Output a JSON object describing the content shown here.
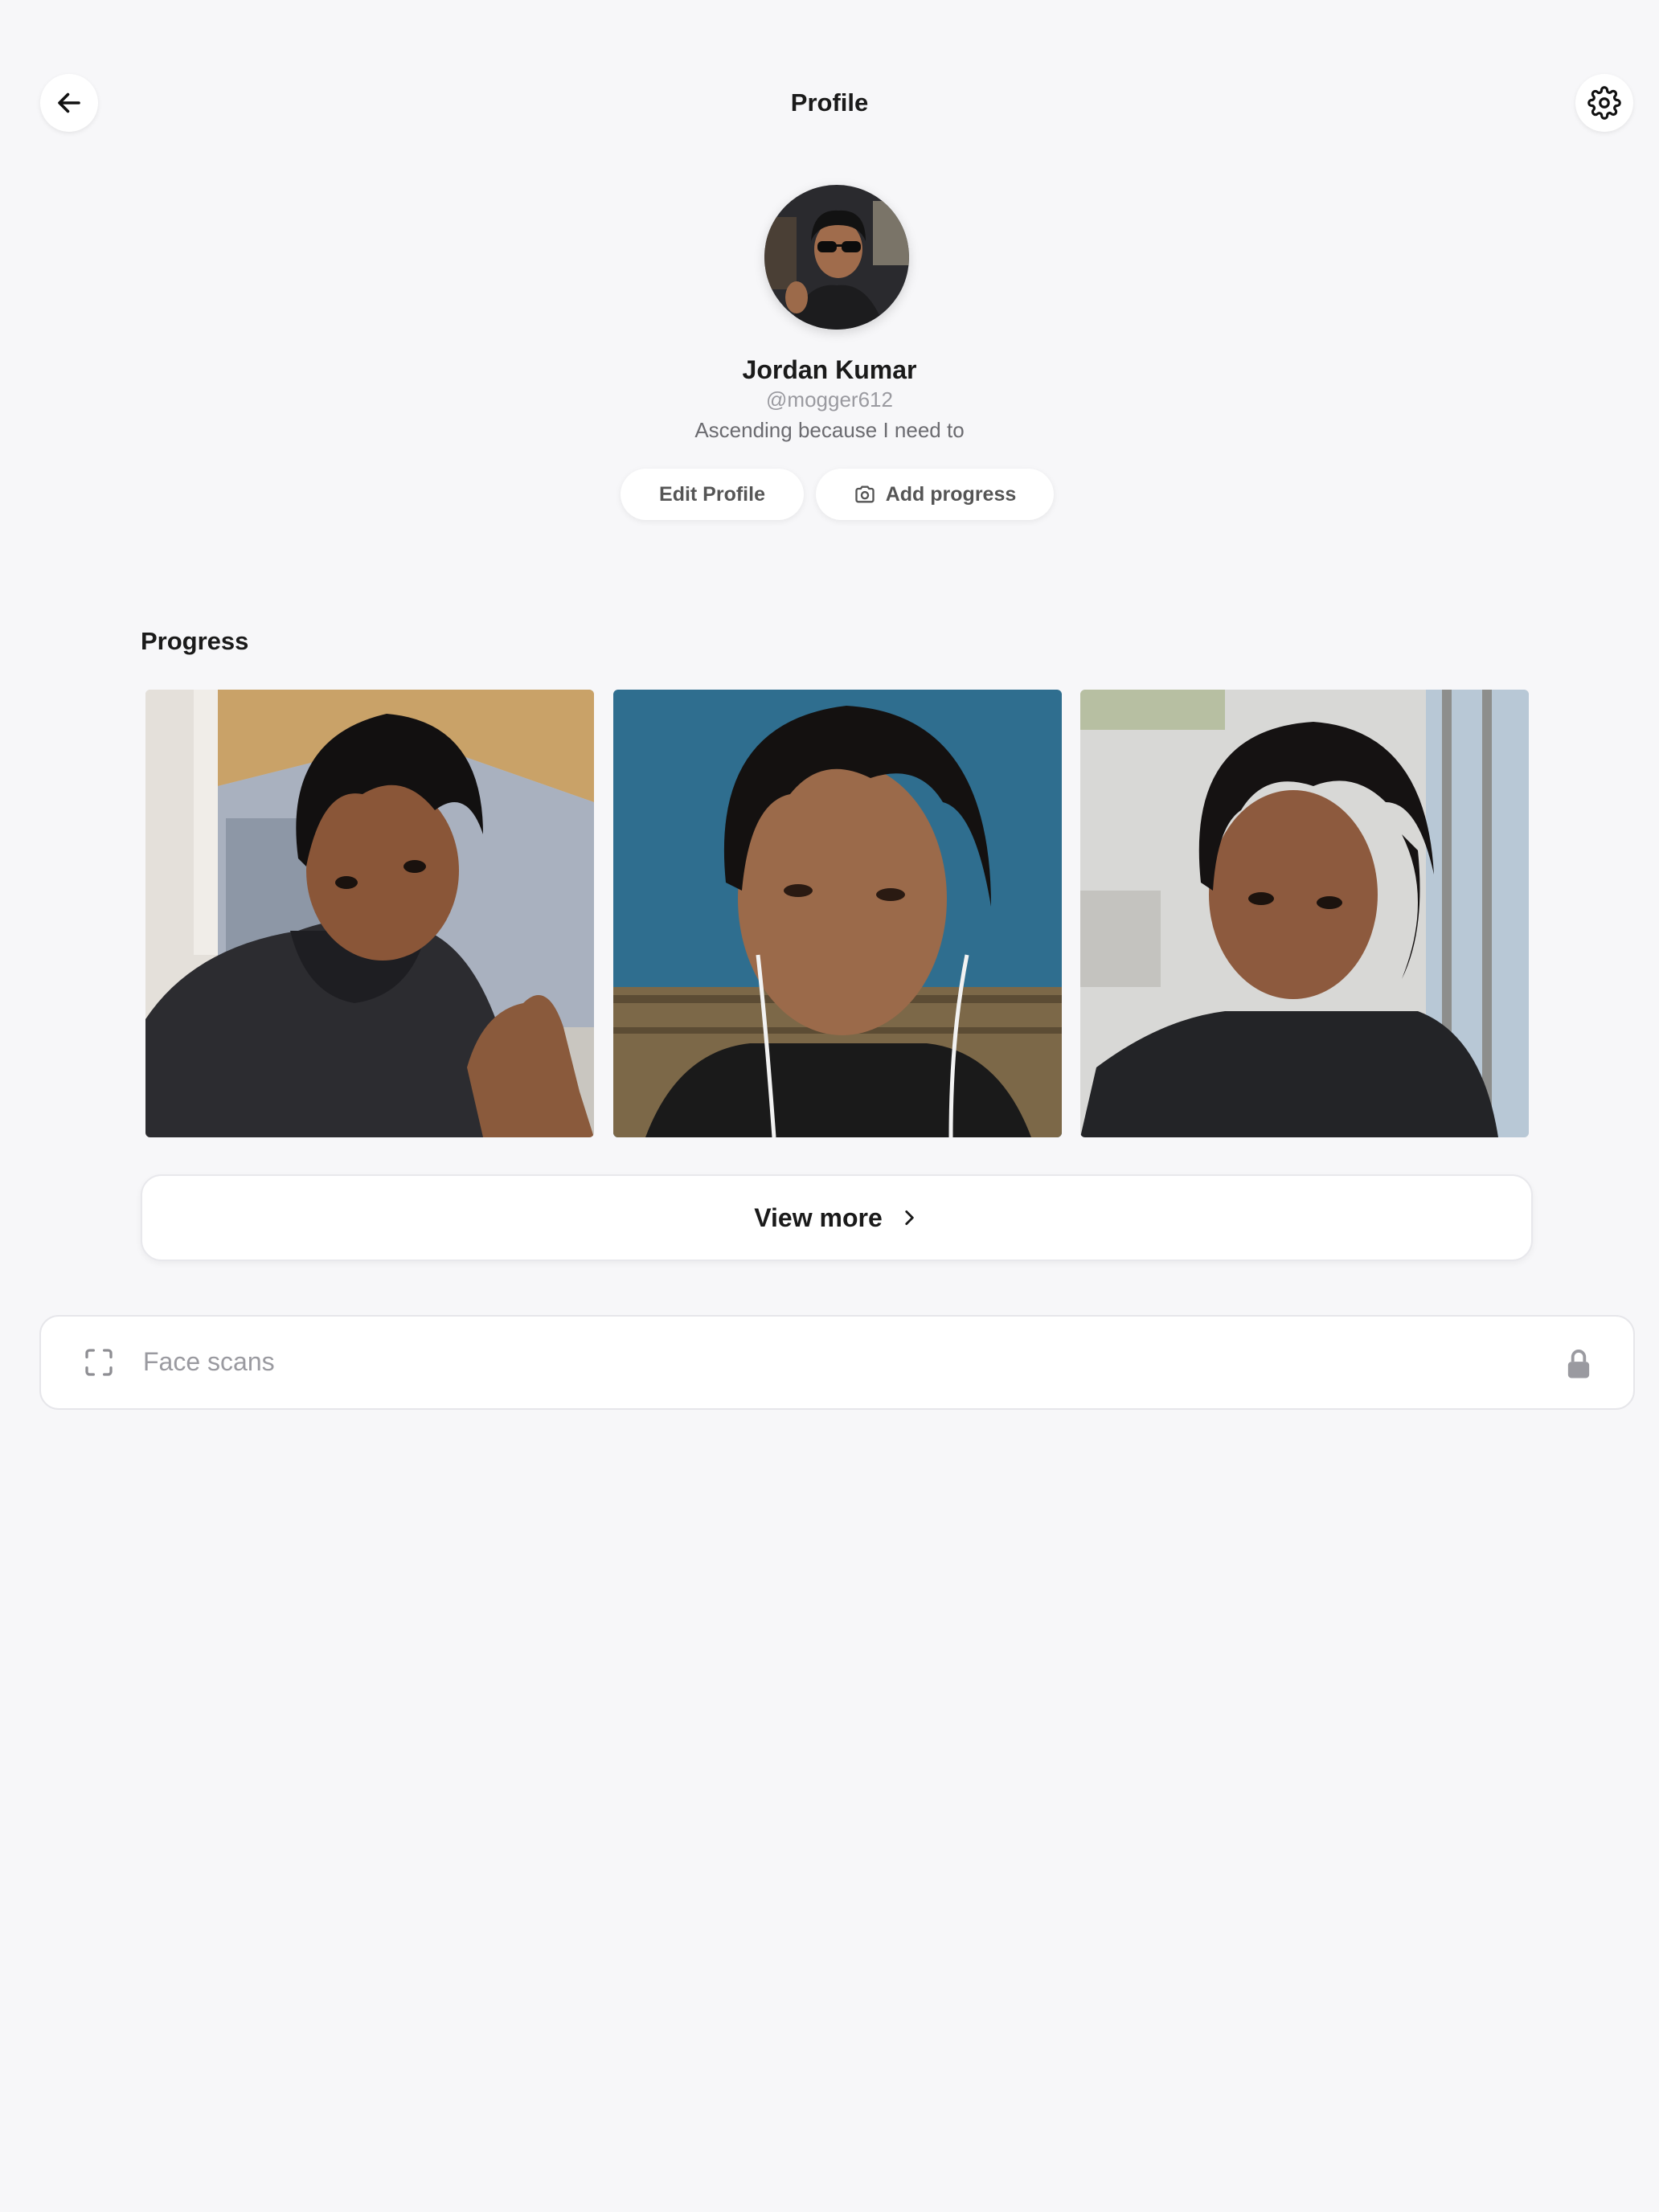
{
  "header": {
    "title": "Profile",
    "back_icon": "arrow-left-icon",
    "settings_icon": "gear-icon"
  },
  "profile": {
    "name": "Jordan Kumar",
    "handle": "@mogger612",
    "bio": "Ascending because I need to",
    "edit_label": "Edit Profile",
    "add_progress_label": "Add progress",
    "add_progress_icon": "camera-icon"
  },
  "progress": {
    "section_title": "Progress",
    "photos": [
      {
        "name": "progress-photo-1"
      },
      {
        "name": "progress-photo-2"
      },
      {
        "name": "progress-photo-3"
      }
    ],
    "view_more_label": "View more"
  },
  "face_scans": {
    "label": "Face scans",
    "icon": "scan-frame-icon",
    "lock_icon": "lock-icon"
  },
  "colors": {
    "background": "#f7f7f9",
    "card": "#ffffff",
    "muted_text": "#9a9aa0"
  }
}
